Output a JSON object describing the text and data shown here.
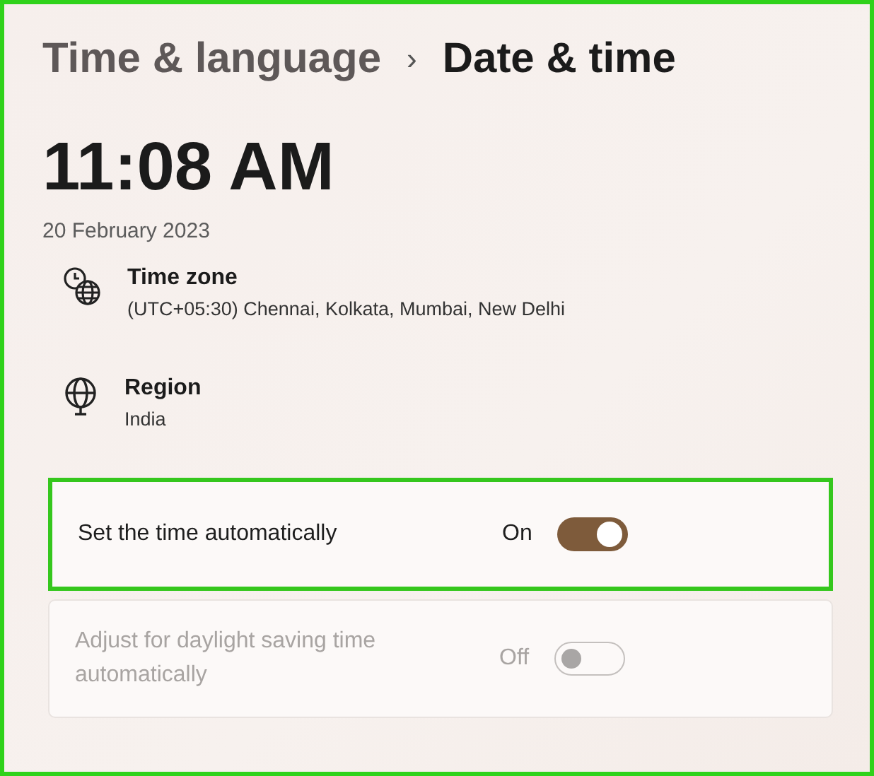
{
  "breadcrumb": {
    "parent": "Time & language",
    "separator": "›",
    "current": "Date & time"
  },
  "clock": {
    "time": "11:08 AM",
    "date": "20 February 2023"
  },
  "info_rows": [
    {
      "kind": "timezone",
      "title": "Time zone",
      "value": "(UTC+05:30) Chennai, Kolkata, Mumbai, New Delhi"
    },
    {
      "kind": "region",
      "title": "Region",
      "value": "India"
    }
  ],
  "settings": [
    {
      "label": "Set the time automatically",
      "state_text": "On",
      "on": true,
      "disabled": false,
      "highlighted": true
    },
    {
      "label": "Adjust for daylight saving time automatically",
      "state_text": "Off",
      "on": false,
      "disabled": true,
      "highlighted": false
    }
  ]
}
